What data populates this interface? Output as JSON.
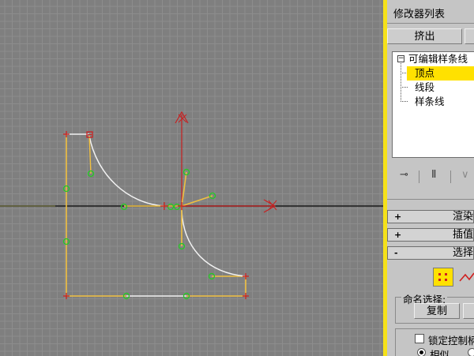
{
  "panel": {
    "modifier_list_label": "修改器列表",
    "extrude_button": "挤出",
    "stack": {
      "root": "可编辑样条线",
      "items": [
        "顶点",
        "线段",
        "样条线"
      ],
      "selected_index": 0
    },
    "rollouts": {
      "render": "渲染",
      "interpolation": "插值",
      "selection": "选择"
    },
    "named_selection": {
      "label": "命名选择:",
      "copy_button": "复制"
    },
    "lock_handles": {
      "label": "锁定控制柄",
      "checked": false
    },
    "similar_radio": {
      "label": "相似",
      "checked": true
    }
  },
  "colors": {
    "selection_highlight": "#ffe100",
    "viewport_border": "#f5e11a",
    "spline_segment": "#f0c040",
    "vertex_marker": "#22cc22",
    "gizmo_red": "#c82020"
  },
  "icons": {
    "pin": "pin-stack-icon",
    "show_end": "show-end-result-icon",
    "make_unique": "make-unique-icon",
    "vertex_selection": "vertex-selection-icon",
    "segment_selection": "segment-selection-icon"
  }
}
